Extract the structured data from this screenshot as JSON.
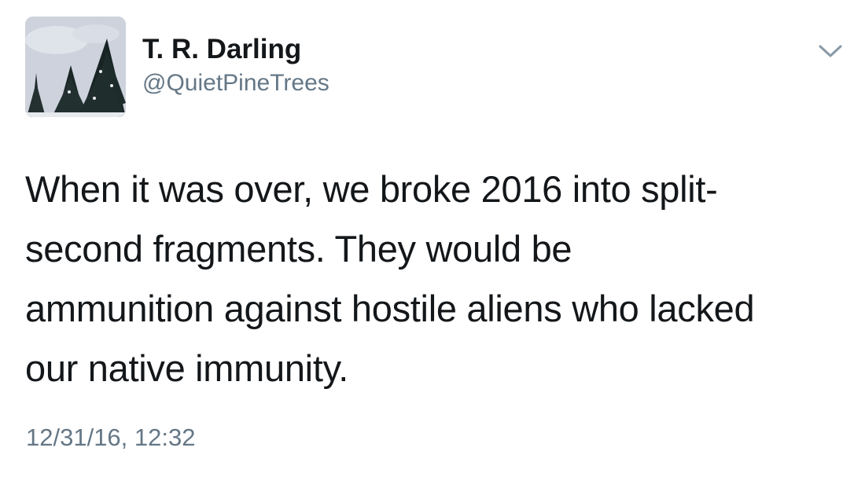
{
  "author": {
    "display_name": "T. R. Darling",
    "handle": "@QuietPineTrees",
    "avatar_icon": "pine-trees-avatar"
  },
  "menu": {
    "icon": "chevron-down-icon"
  },
  "tweet": {
    "lines": [
      "When it was over, we broke 2016 into split-",
      "second fragments. They would be",
      "ammunition against hostile aliens who lacked",
      "our native immunity."
    ],
    "timestamp": "12/31/16, 12:32"
  },
  "colors": {
    "text_primary": "#14171a",
    "text_secondary": "#657786",
    "background": "#ffffff"
  }
}
